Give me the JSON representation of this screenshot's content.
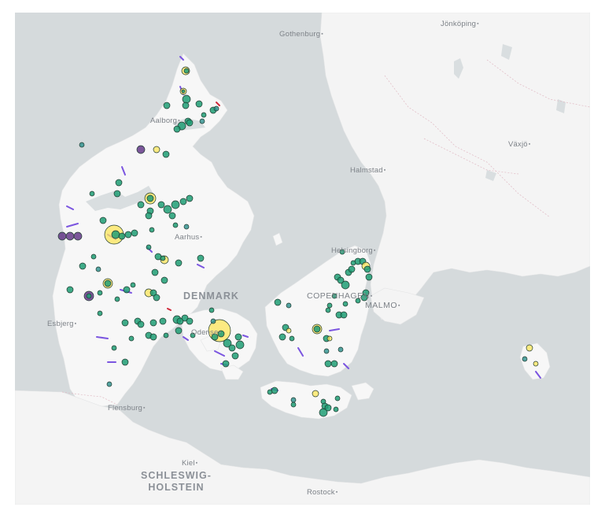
{
  "map": {
    "cities": [
      {
        "name": "Gothenburg"
      },
      {
        "name": "Jönköping"
      },
      {
        "name": "Aalborg"
      },
      {
        "name": "Växjö"
      },
      {
        "name": "Halmstad"
      },
      {
        "name": "Aarhus"
      },
      {
        "name": "Helsingborg"
      },
      {
        "name": "COPENHAGEN"
      },
      {
        "name": "MALMO"
      },
      {
        "name": "Esbjerg"
      },
      {
        "name": "Odense"
      },
      {
        "name": "Flensburg"
      },
      {
        "name": "Kiel"
      },
      {
        "name": "Rostock"
      }
    ],
    "regions": [
      {
        "name": "DENMARK"
      },
      {
        "name": "SCHLESWIG-\nHOLSTEIN"
      }
    ],
    "colors": {
      "water": "#d5dadc",
      "land": "#f7f7f7",
      "point_green": "#1e9e74",
      "point_teal": "#2a8f8c",
      "point_yellow": "#fde659",
      "point_purple": "#5b2d82",
      "route_purple": "#7b55e0",
      "route_red": "#d0283a"
    }
  }
}
